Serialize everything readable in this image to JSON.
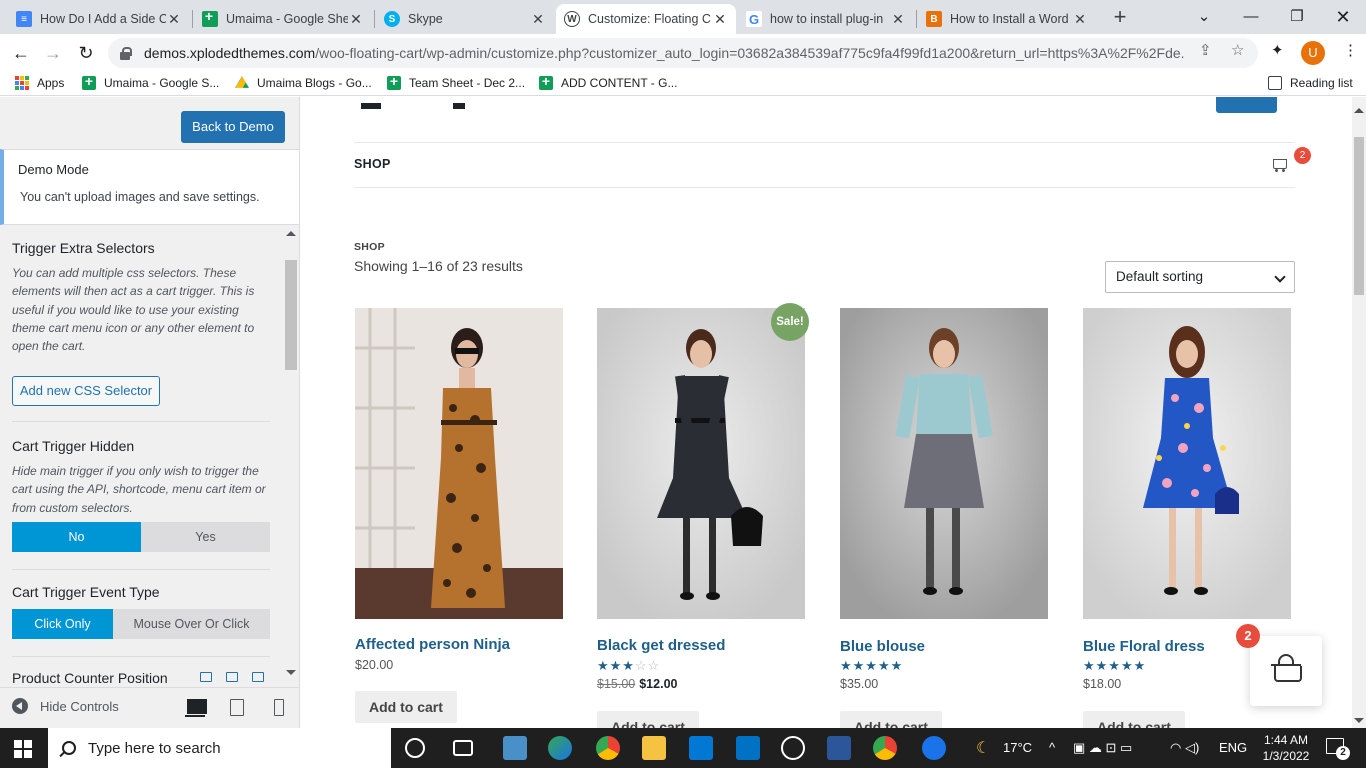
{
  "browser": {
    "tabs": [
      {
        "label": "How Do I Add a Side C",
        "icon": "google-docs-icon",
        "color": "#4285f4"
      },
      {
        "label": "Umaima - Google She",
        "icon": "google-sheets-icon",
        "color": "#0f9d58"
      },
      {
        "label": "Skype",
        "icon": "skype-icon",
        "color": "#00aff0"
      },
      {
        "label": "Customize: Floating C",
        "icon": "wordpress-icon",
        "color": "#3c4043"
      },
      {
        "label": "how to install plug-in",
        "icon": "google-icon",
        "color": "#4285f4"
      },
      {
        "label": "How to Install a Word",
        "icon": "blogger-icon",
        "color": "#e8710a"
      }
    ],
    "url_domain": "demos.xplodedthemes.com",
    "url_path": "/woo-floating-cart/wp-admin/customize.php?customizer_auto_login=03682a384539af775c9fa4f99fd1a200&return_url=https%3A%2F%2Fde...",
    "profile_initial": "U",
    "bookmarks": [
      {
        "label": "Apps",
        "icon": "apps-grid-icon"
      },
      {
        "label": "Umaima - Google S...",
        "icon": "google-sheets-icon"
      },
      {
        "label": "Umaima Blogs - Go...",
        "icon": "google-drive-icon"
      },
      {
        "label": "Team Sheet - Dec 2...",
        "icon": "google-sheets-icon"
      },
      {
        "label": "ADD CONTENT - G...",
        "icon": "google-sheets-icon"
      }
    ],
    "reading_list": "Reading list"
  },
  "sidebar": {
    "back_button": "Back to Demo",
    "demo_title": "Demo Mode",
    "demo_text": "You can't upload images and save settings.",
    "trigger_extra_title": "Trigger Extra Selectors",
    "trigger_extra_desc": "You can add multiple css selectors. These elements will then act as a cart trigger. This is useful if you would like to use your existing theme cart menu icon or any other element to open the cart.",
    "add_css_button": "Add new CSS Selector",
    "hidden_title": "Cart Trigger Hidden",
    "hidden_desc": "Hide main trigger if you only wish to trigger the cart using the API, shortcode, menu cart item or from custom selectors.",
    "hidden_options": [
      "No",
      "Yes"
    ],
    "event_title": "Cart Trigger Event Type",
    "event_options": [
      "Click Only",
      "Mouse Over Or Click"
    ],
    "counter_title": "Product Counter Position",
    "hide_controls": "Hide Controls"
  },
  "preview": {
    "nav_shop": "SHOP",
    "cart_count": "2",
    "breadcrumb": "SHOP",
    "results": "Showing 1–16 of 23 results",
    "sort": "Default sorting",
    "add_to_cart": "Add to cart",
    "products": [
      {
        "name": "Affected person Ninja",
        "price": "$20.00",
        "old_price": "",
        "rating": 0,
        "sale": ""
      },
      {
        "name": "Black get dressed",
        "price": "$12.00",
        "old_price": "$15.00",
        "rating": 3,
        "sale": "Sale!"
      },
      {
        "name": "Blue blouse",
        "price": "$35.00",
        "old_price": "",
        "rating": 5,
        "sale": ""
      },
      {
        "name": "Blue Floral dress",
        "price": "$18.00",
        "old_price": "",
        "rating": 5,
        "sale": ""
      }
    ],
    "floating_cart_count": "2"
  },
  "taskbar": {
    "search_placeholder": "Type here to search",
    "weather": "17°C",
    "language": "ENG",
    "time": "1:44 AM",
    "date": "1/3/2022",
    "notification_count": "2"
  },
  "colors": {
    "wp_blue": "#2271b1",
    "toggle_active": "#0096d6",
    "sale_green": "#77a464",
    "badge_red": "#e74c3c",
    "product_link": "#1f5f8a"
  }
}
